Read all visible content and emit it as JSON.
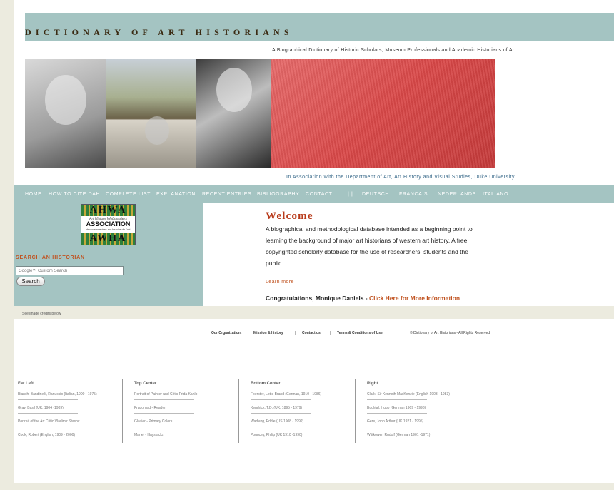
{
  "header": {
    "site_title": "DICTIONARY OF ART HISTORIANS",
    "subtitle": "A Biographical Dictionary of Historic Scholars, Museum Professionals and Academic Historians of Art",
    "association": "In Association with the Department of Art, Art History and Visual Studies, Duke University"
  },
  "nav": {
    "items": [
      "HOME",
      "HOW TO CITE DAH",
      "COMPLETE LIST",
      "EXPLANATION",
      "RECENT ENTRIES",
      "BIBLIOGRAPHY",
      "CONTACT",
      "| |",
      "DEUTSCH",
      "FRANCAIS",
      "NEDERLANDS",
      "ITALIANO"
    ]
  },
  "sidebar": {
    "logo": {
      "top": "AHWA",
      "line1": "Art History Webmasters",
      "line2": "ASSOCIATION",
      "line3": "des webmestres en histoire de l'art",
      "bottom": "AWHA"
    },
    "search_label": "SEARCH AN HISTORIAN",
    "search_placeholder": "Google™ Custom Search",
    "search_button": "Search"
  },
  "main": {
    "welcome": "Welcome",
    "intro": "A biographical and methodological database intended as a beginning point to learning the background of major art historians of western art history. A free, copyrighted scholarly database for the use of researchers, students and the public.",
    "learn_more": "Learn more",
    "congrats_text": "Congratulations, Monique Daniels - ",
    "congrats_link": "Click Here for More Information"
  },
  "credits_note": "See image credits below",
  "footer": {
    "org_label": "Our Organization:",
    "mission": "Mission & history",
    "contact": "Contact us",
    "terms": "Terms & Conditions of Use",
    "copyright": "© Dictionary of Art Historians - All Rights Reserved."
  },
  "credits": {
    "columns": [
      {
        "head": "Far Left",
        "items": [
          "Bianchi Bandinelli, Ranuccio (Italian, 1900 - 1975)",
          "Gray, Basil (UK, 1904 -1989)",
          "Portrait of the Art Critic Vladimir Stasov",
          "Cook, Robert (English, 1909 - 2000)"
        ]
      },
      {
        "head": "Top Center",
        "items": [
          "Portrait of Painter and Critic Frida Kahlo",
          "Fragonard - Reader",
          "Glazier - Primary Colors",
          "Manet - Haystacks"
        ]
      },
      {
        "head": "Bottom Center",
        "items": [
          "Foerster, Lotte Brand (German, 1910 - 1986)",
          "Kendrick, T.D. (UK, 1895 - 1979)",
          "Warburg, Eddie (US 1908 - 1992)",
          "Pouncey, Philip (UK 1910 -1990)"
        ]
      },
      {
        "head": "Right",
        "items": [
          "Clark, Sir Kenneth MacKenzie (English 1903 - 1983)",
          "Buchtal, Hugo (German 1909 - 1996)",
          "Gere, John Arthur (UK 1921 - 1995)",
          "Wittkower, Rudolf (German 1901 -1971)"
        ]
      }
    ]
  }
}
